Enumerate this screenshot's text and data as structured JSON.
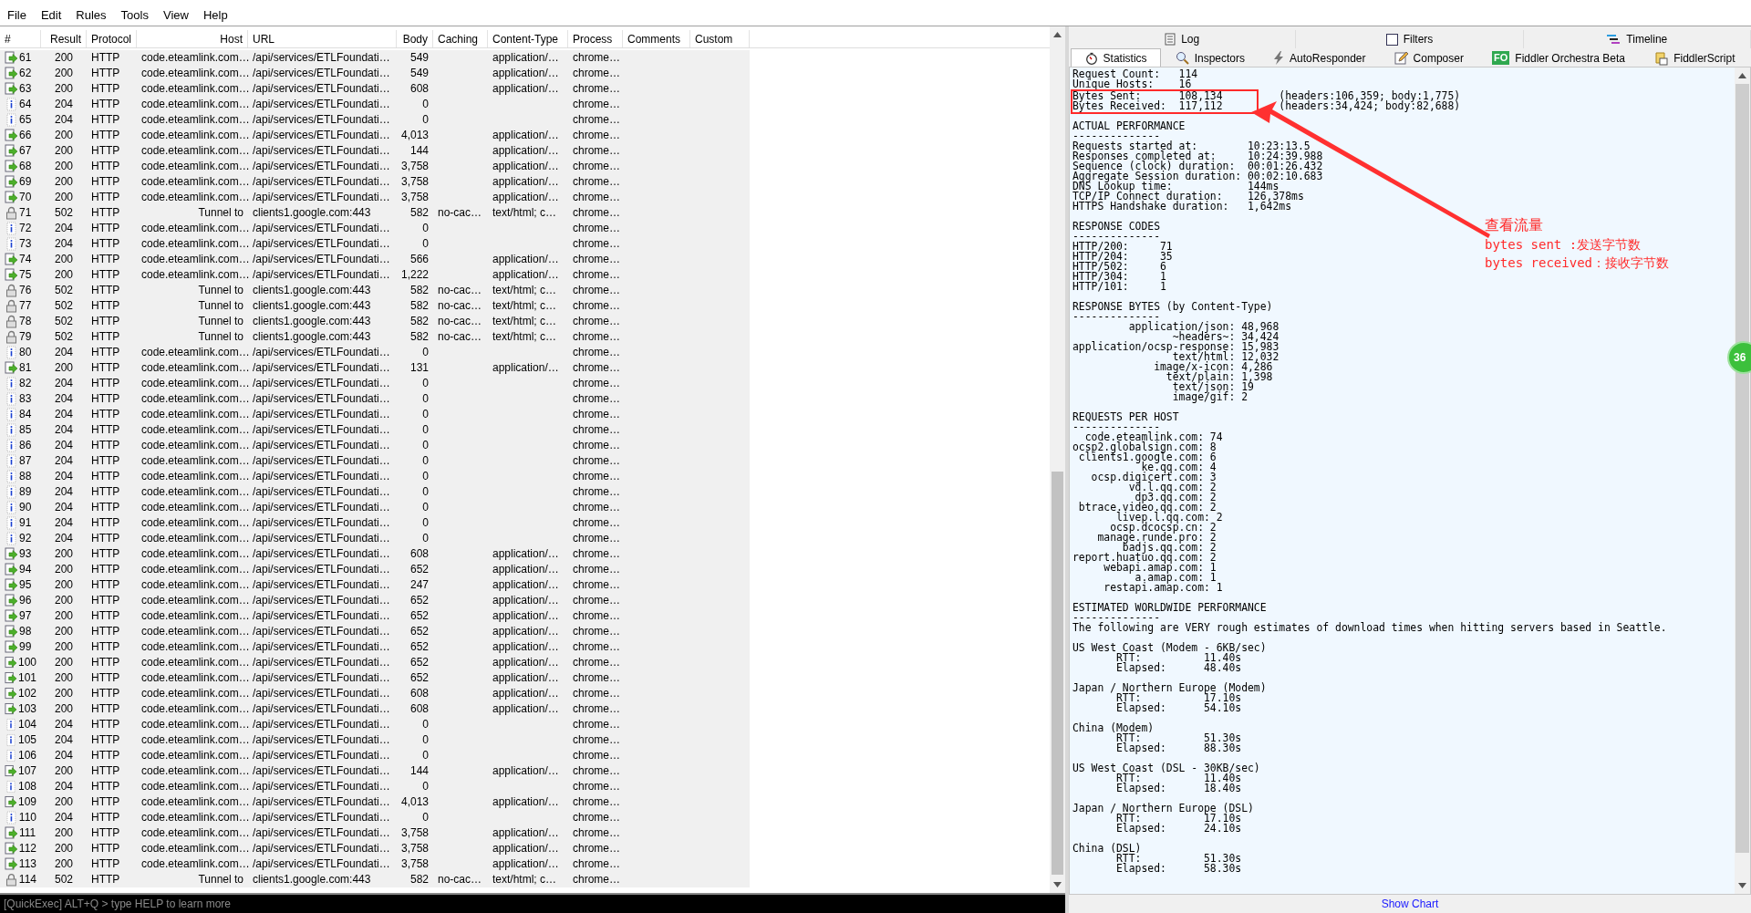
{
  "menu": [
    "File",
    "Edit",
    "Rules",
    "Tools",
    "View",
    "Help"
  ],
  "columns": [
    "#",
    "Result",
    "Protocol",
    "Host",
    "URL",
    "Body",
    "Caching",
    "Content-Type",
    "Process",
    "Comments",
    "Custom"
  ],
  "rows": [
    {
      "id": "61",
      "kind": "json",
      "result": "200",
      "protocol": "HTTP",
      "host": "code.eteamlink.com…",
      "url": "/api/services/ETLFoundati…",
      "body": "549",
      "content_type": "application/…",
      "process": "chrome…"
    },
    {
      "id": "62",
      "kind": "json",
      "result": "200",
      "protocol": "HTTP",
      "host": "code.eteamlink.com…",
      "url": "/api/services/ETLFoundati…",
      "body": "549",
      "content_type": "application/…",
      "process": "chrome…"
    },
    {
      "id": "63",
      "kind": "json",
      "result": "200",
      "protocol": "HTTP",
      "host": "code.eteamlink.com…",
      "url": "/api/services/ETLFoundati…",
      "body": "608",
      "content_type": "application/…",
      "process": "chrome…"
    },
    {
      "id": "64",
      "kind": "info",
      "result": "204",
      "protocol": "HTTP",
      "host": "code.eteamlink.com…",
      "url": "/api/services/ETLFoundati…",
      "body": "0",
      "process": "chrome…"
    },
    {
      "id": "65",
      "kind": "info",
      "result": "204",
      "protocol": "HTTP",
      "host": "code.eteamlink.com…",
      "url": "/api/services/ETLFoundati…",
      "body": "0",
      "process": "chrome…"
    },
    {
      "id": "66",
      "kind": "json",
      "result": "200",
      "protocol": "HTTP",
      "host": "code.eteamlink.com…",
      "url": "/api/services/ETLFoundati…",
      "body": "4,013",
      "content_type": "application/…",
      "process": "chrome…"
    },
    {
      "id": "67",
      "kind": "json",
      "result": "200",
      "protocol": "HTTP",
      "host": "code.eteamlink.com…",
      "url": "/api/services/ETLFoundati…",
      "body": "144",
      "content_type": "application/…",
      "process": "chrome…"
    },
    {
      "id": "68",
      "kind": "json",
      "result": "200",
      "protocol": "HTTP",
      "host": "code.eteamlink.com…",
      "url": "/api/services/ETLFoundati…",
      "body": "3,758",
      "content_type": "application/…",
      "process": "chrome…"
    },
    {
      "id": "69",
      "kind": "json",
      "result": "200",
      "protocol": "HTTP",
      "host": "code.eteamlink.com…",
      "url": "/api/services/ETLFoundati…",
      "body": "3,758",
      "content_type": "application/…",
      "process": "chrome…"
    },
    {
      "id": "70",
      "kind": "json",
      "result": "200",
      "protocol": "HTTP",
      "host": "code.eteamlink.com…",
      "url": "/api/services/ETLFoundati…",
      "body": "3,758",
      "content_type": "application/…",
      "process": "chrome…"
    },
    {
      "id": "71",
      "kind": "lock",
      "result": "502",
      "protocol": "HTTP",
      "host": "Tunnel to",
      "url": "clients1.google.com:443",
      "body": "582",
      "caching": "no-cac…",
      "content_type": "text/html; c…",
      "process": "chrome…"
    },
    {
      "id": "72",
      "kind": "info",
      "result": "204",
      "protocol": "HTTP",
      "host": "code.eteamlink.com…",
      "url": "/api/services/ETLFoundati…",
      "body": "0",
      "process": "chrome…"
    },
    {
      "id": "73",
      "kind": "info",
      "result": "204",
      "protocol": "HTTP",
      "host": "code.eteamlink.com…",
      "url": "/api/services/ETLFoundati…",
      "body": "0",
      "process": "chrome…"
    },
    {
      "id": "74",
      "kind": "json",
      "result": "200",
      "protocol": "HTTP",
      "host": "code.eteamlink.com…",
      "url": "/api/services/ETLFoundati…",
      "body": "566",
      "content_type": "application/…",
      "process": "chrome…"
    },
    {
      "id": "75",
      "kind": "json",
      "result": "200",
      "protocol": "HTTP",
      "host": "code.eteamlink.com…",
      "url": "/api/services/ETLFoundati…",
      "body": "1,222",
      "content_type": "application/…",
      "process": "chrome…"
    },
    {
      "id": "76",
      "kind": "lock",
      "result": "502",
      "protocol": "HTTP",
      "host": "Tunnel to",
      "url": "clients1.google.com:443",
      "body": "582",
      "caching": "no-cac…",
      "content_type": "text/html; c…",
      "process": "chrome…"
    },
    {
      "id": "77",
      "kind": "lock",
      "result": "502",
      "protocol": "HTTP",
      "host": "Tunnel to",
      "url": "clients1.google.com:443",
      "body": "582",
      "caching": "no-cac…",
      "content_type": "text/html; c…",
      "process": "chrome…"
    },
    {
      "id": "78",
      "kind": "lock",
      "result": "502",
      "protocol": "HTTP",
      "host": "Tunnel to",
      "url": "clients1.google.com:443",
      "body": "582",
      "caching": "no-cac…",
      "content_type": "text/html; c…",
      "process": "chrome…"
    },
    {
      "id": "79",
      "kind": "lock",
      "result": "502",
      "protocol": "HTTP",
      "host": "Tunnel to",
      "url": "clients1.google.com:443",
      "body": "582",
      "caching": "no-cac…",
      "content_type": "text/html; c…",
      "process": "chrome…"
    },
    {
      "id": "80",
      "kind": "info",
      "result": "204",
      "protocol": "HTTP",
      "host": "code.eteamlink.com…",
      "url": "/api/services/ETLFoundati…",
      "body": "0",
      "process": "chrome…"
    },
    {
      "id": "81",
      "kind": "json",
      "result": "200",
      "protocol": "HTTP",
      "host": "code.eteamlink.com…",
      "url": "/api/services/ETLFoundati…",
      "body": "131",
      "content_type": "application/…",
      "process": "chrome…"
    },
    {
      "id": "82",
      "kind": "info",
      "result": "204",
      "protocol": "HTTP",
      "host": "code.eteamlink.com…",
      "url": "/api/services/ETLFoundati…",
      "body": "0",
      "process": "chrome…"
    },
    {
      "id": "83",
      "kind": "info",
      "result": "204",
      "protocol": "HTTP",
      "host": "code.eteamlink.com…",
      "url": "/api/services/ETLFoundati…",
      "body": "0",
      "process": "chrome…"
    },
    {
      "id": "84",
      "kind": "info",
      "result": "204",
      "protocol": "HTTP",
      "host": "code.eteamlink.com…",
      "url": "/api/services/ETLFoundati…",
      "body": "0",
      "process": "chrome…"
    },
    {
      "id": "85",
      "kind": "info",
      "result": "204",
      "protocol": "HTTP",
      "host": "code.eteamlink.com…",
      "url": "/api/services/ETLFoundati…",
      "body": "0",
      "process": "chrome…"
    },
    {
      "id": "86",
      "kind": "info",
      "result": "204",
      "protocol": "HTTP",
      "host": "code.eteamlink.com…",
      "url": "/api/services/ETLFoundati…",
      "body": "0",
      "process": "chrome…"
    },
    {
      "id": "87",
      "kind": "info",
      "result": "204",
      "protocol": "HTTP",
      "host": "code.eteamlink.com…",
      "url": "/api/services/ETLFoundati…",
      "body": "0",
      "process": "chrome…"
    },
    {
      "id": "88",
      "kind": "info",
      "result": "204",
      "protocol": "HTTP",
      "host": "code.eteamlink.com…",
      "url": "/api/services/ETLFoundati…",
      "body": "0",
      "process": "chrome…"
    },
    {
      "id": "89",
      "kind": "info",
      "result": "204",
      "protocol": "HTTP",
      "host": "code.eteamlink.com…",
      "url": "/api/services/ETLFoundati…",
      "body": "0",
      "process": "chrome…"
    },
    {
      "id": "90",
      "kind": "info",
      "result": "204",
      "protocol": "HTTP",
      "host": "code.eteamlink.com…",
      "url": "/api/services/ETLFoundati…",
      "body": "0",
      "process": "chrome…"
    },
    {
      "id": "91",
      "kind": "info",
      "result": "204",
      "protocol": "HTTP",
      "host": "code.eteamlink.com…",
      "url": "/api/services/ETLFoundati…",
      "body": "0",
      "process": "chrome…"
    },
    {
      "id": "92",
      "kind": "info",
      "result": "204",
      "protocol": "HTTP",
      "host": "code.eteamlink.com…",
      "url": "/api/services/ETLFoundati…",
      "body": "0",
      "process": "chrome…"
    },
    {
      "id": "93",
      "kind": "json",
      "result": "200",
      "protocol": "HTTP",
      "host": "code.eteamlink.com…",
      "url": "/api/services/ETLFoundati…",
      "body": "608",
      "content_type": "application/…",
      "process": "chrome…"
    },
    {
      "id": "94",
      "kind": "json",
      "result": "200",
      "protocol": "HTTP",
      "host": "code.eteamlink.com…",
      "url": "/api/services/ETLFoundati…",
      "body": "652",
      "content_type": "application/…",
      "process": "chrome…"
    },
    {
      "id": "95",
      "kind": "json",
      "result": "200",
      "protocol": "HTTP",
      "host": "code.eteamlink.com…",
      "url": "/api/services/ETLFoundati…",
      "body": "247",
      "content_type": "application/…",
      "process": "chrome…"
    },
    {
      "id": "96",
      "kind": "json",
      "result": "200",
      "protocol": "HTTP",
      "host": "code.eteamlink.com…",
      "url": "/api/services/ETLFoundati…",
      "body": "652",
      "content_type": "application/…",
      "process": "chrome…"
    },
    {
      "id": "97",
      "kind": "json",
      "result": "200",
      "protocol": "HTTP",
      "host": "code.eteamlink.com…",
      "url": "/api/services/ETLFoundati…",
      "body": "652",
      "content_type": "application/…",
      "process": "chrome…"
    },
    {
      "id": "98",
      "kind": "json",
      "result": "200",
      "protocol": "HTTP",
      "host": "code.eteamlink.com…",
      "url": "/api/services/ETLFoundati…",
      "body": "652",
      "content_type": "application/…",
      "process": "chrome…"
    },
    {
      "id": "99",
      "kind": "json",
      "result": "200",
      "protocol": "HTTP",
      "host": "code.eteamlink.com…",
      "url": "/api/services/ETLFoundati…",
      "body": "652",
      "content_type": "application/…",
      "process": "chrome…"
    },
    {
      "id": "100",
      "kind": "json",
      "result": "200",
      "protocol": "HTTP",
      "host": "code.eteamlink.com…",
      "url": "/api/services/ETLFoundati…",
      "body": "652",
      "content_type": "application/…",
      "process": "chrome…"
    },
    {
      "id": "101",
      "kind": "json",
      "result": "200",
      "protocol": "HTTP",
      "host": "code.eteamlink.com…",
      "url": "/api/services/ETLFoundati…",
      "body": "652",
      "content_type": "application/…",
      "process": "chrome…"
    },
    {
      "id": "102",
      "kind": "json",
      "result": "200",
      "protocol": "HTTP",
      "host": "code.eteamlink.com…",
      "url": "/api/services/ETLFoundati…",
      "body": "608",
      "content_type": "application/…",
      "process": "chrome…"
    },
    {
      "id": "103",
      "kind": "json",
      "result": "200",
      "protocol": "HTTP",
      "host": "code.eteamlink.com…",
      "url": "/api/services/ETLFoundati…",
      "body": "608",
      "content_type": "application/…",
      "process": "chrome…"
    },
    {
      "id": "104",
      "kind": "info",
      "result": "204",
      "protocol": "HTTP",
      "host": "code.eteamlink.com…",
      "url": "/api/services/ETLFoundati…",
      "body": "0",
      "process": "chrome…"
    },
    {
      "id": "105",
      "kind": "info",
      "result": "204",
      "protocol": "HTTP",
      "host": "code.eteamlink.com…",
      "url": "/api/services/ETLFoundati…",
      "body": "0",
      "process": "chrome…"
    },
    {
      "id": "106",
      "kind": "info",
      "result": "204",
      "protocol": "HTTP",
      "host": "code.eteamlink.com…",
      "url": "/api/services/ETLFoundati…",
      "body": "0",
      "process": "chrome…"
    },
    {
      "id": "107",
      "kind": "json",
      "result": "200",
      "protocol": "HTTP",
      "host": "code.eteamlink.com…",
      "url": "/api/services/ETLFoundati…",
      "body": "144",
      "content_type": "application/…",
      "process": "chrome…"
    },
    {
      "id": "108",
      "kind": "info",
      "result": "204",
      "protocol": "HTTP",
      "host": "code.eteamlink.com…",
      "url": "/api/services/ETLFoundati…",
      "body": "0",
      "process": "chrome…"
    },
    {
      "id": "109",
      "kind": "json",
      "result": "200",
      "protocol": "HTTP",
      "host": "code.eteamlink.com…",
      "url": "/api/services/ETLFoundati…",
      "body": "4,013",
      "content_type": "application/…",
      "process": "chrome…"
    },
    {
      "id": "110",
      "kind": "info",
      "result": "204",
      "protocol": "HTTP",
      "host": "code.eteamlink.com…",
      "url": "/api/services/ETLFoundati…",
      "body": "0",
      "process": "chrome…"
    },
    {
      "id": "111",
      "kind": "json",
      "result": "200",
      "protocol": "HTTP",
      "host": "code.eteamlink.com…",
      "url": "/api/services/ETLFoundati…",
      "body": "3,758",
      "content_type": "application/…",
      "process": "chrome…"
    },
    {
      "id": "112",
      "kind": "json",
      "result": "200",
      "protocol": "HTTP",
      "host": "code.eteamlink.com…",
      "url": "/api/services/ETLFoundati…",
      "body": "3,758",
      "content_type": "application/…",
      "process": "chrome…"
    },
    {
      "id": "113",
      "kind": "json",
      "result": "200",
      "protocol": "HTTP",
      "host": "code.eteamlink.com…",
      "url": "/api/services/ETLFoundati…",
      "body": "3,758",
      "content_type": "application/…",
      "process": "chrome…"
    },
    {
      "id": "114",
      "kind": "lock",
      "result": "502",
      "protocol": "HTTP",
      "host": "Tunnel to",
      "url": "clients1.google.com:443",
      "body": "582",
      "caching": "no-cac…",
      "content_type": "text/html; c…",
      "process": "chrome…"
    }
  ],
  "quickexec": {
    "placeholder": "[QuickExec] ALT+Q > type HELP to learn more"
  },
  "top_tabs": [
    {
      "label": "Log"
    },
    {
      "label": "Filters"
    },
    {
      "label": "Timeline"
    }
  ],
  "tabs": [
    {
      "label": "Statistics",
      "selected": true
    },
    {
      "label": "Inspectors",
      "selected": false
    },
    {
      "label": "AutoResponder",
      "selected": false
    },
    {
      "label": "Composer",
      "selected": false
    },
    {
      "label": "Fiddler Orchestra Beta",
      "icon_text": "FO",
      "selected": false
    },
    {
      "label": "FiddlerScript",
      "selected": false
    }
  ],
  "statistics": [
    {
      "lines": [
        "Request Count:   114",
        "Unique Hosts:    16"
      ],
      "highlighted_lines": [
        "Bytes Sent:      108,134         (headers:106,359; body:1,775)",
        "Bytes Received:  117,112         (headers:34,424; body:82,688)"
      ]
    },
    {
      "lines": [
        "ACTUAL PERFORMANCE",
        "--------------",
        "Requests started at:        10:23:13.5",
        "Responses completed at:     10:24:39.988",
        "Sequence (clock) duration:  00:01:26.432",
        "Aggregate Session duration: 00:02:10.683",
        "DNS Lookup time:            144ms",
        "TCP/IP Connect duration:    126,378ms",
        "HTTPS Handshake duration:   1,642ms"
      ]
    },
    {
      "lines": [
        "RESPONSE CODES",
        "--------------",
        "HTTP/200:     71",
        "HTTP/204:     35",
        "HTTP/502:     6",
        "HTTP/304:     1",
        "HTTP/101:     1"
      ]
    },
    {
      "lines": [
        "RESPONSE BYTES (by Content-Type)",
        "--------------",
        "         application/json: 48,968",
        "                ~headers~: 34,424",
        "application/ocsp-response: 15,983",
        "                text/html: 12,032",
        "             image/x-icon: 4,286",
        "               text/plain: 1,398",
        "                text/json: 19",
        "                image/gif: 2"
      ]
    },
    {
      "lines": [
        "REQUESTS PER HOST",
        "--------------",
        "  code.eteamlink.com: 74",
        "ocsp2.globalsign.com: 8",
        " clients1.google.com: 6",
        "           ke.qq.com: 4",
        "   ocsp.digicert.com: 3",
        "         vd.l.qq.com: 2",
        "          dp3.qq.com: 2",
        " btrace.video.qq.com: 2",
        "       livep.l.qq.com: 2",
        "      ocsp.dcocsp.cn: 2",
        "    manage.runde.pro: 2",
        "        badjs.qq.com: 2",
        "report.huatuo.qq.com: 2",
        "     webapi.amap.com: 1",
        "          a.amap.com: 1",
        "     restapi.amap.com: 1"
      ]
    },
    {
      "lines": [
        "ESTIMATED WORLDWIDE PERFORMANCE",
        "--------------",
        "The following are VERY rough estimates of download times when hitting servers based in Seattle."
      ]
    },
    {
      "lines": [
        "US West Coast (Modem - 6KB/sec)",
        "       RTT:          11.40s",
        "       Elapsed:      48.40s"
      ]
    },
    {
      "lines": [
        "Japan / Northern Europe (Modem)",
        "       RTT:          17.10s",
        "       Elapsed:      54.10s"
      ]
    },
    {
      "lines": [
        "China (Modem)",
        "       RTT:          51.30s",
        "       Elapsed:      88.30s"
      ]
    },
    {
      "lines": [
        "US West Coast (DSL - 30KB/sec)",
        "       RTT:          11.40s",
        "       Elapsed:      18.40s"
      ]
    },
    {
      "lines": [
        "Japan / Northern Europe (DSL)",
        "       RTT:          17.10s",
        "       Elapsed:      24.10s"
      ]
    },
    {
      "lines": [
        "China (DSL)",
        "       RTT:          51.30s",
        "       Elapsed:      58.30s"
      ]
    }
  ],
  "annotation": {
    "title": "查看流量",
    "lines": [
      "bytes sent :发送字节数",
      "bytes received：接收字节数"
    ]
  },
  "badge": "36",
  "show_chart": "Show Chart"
}
